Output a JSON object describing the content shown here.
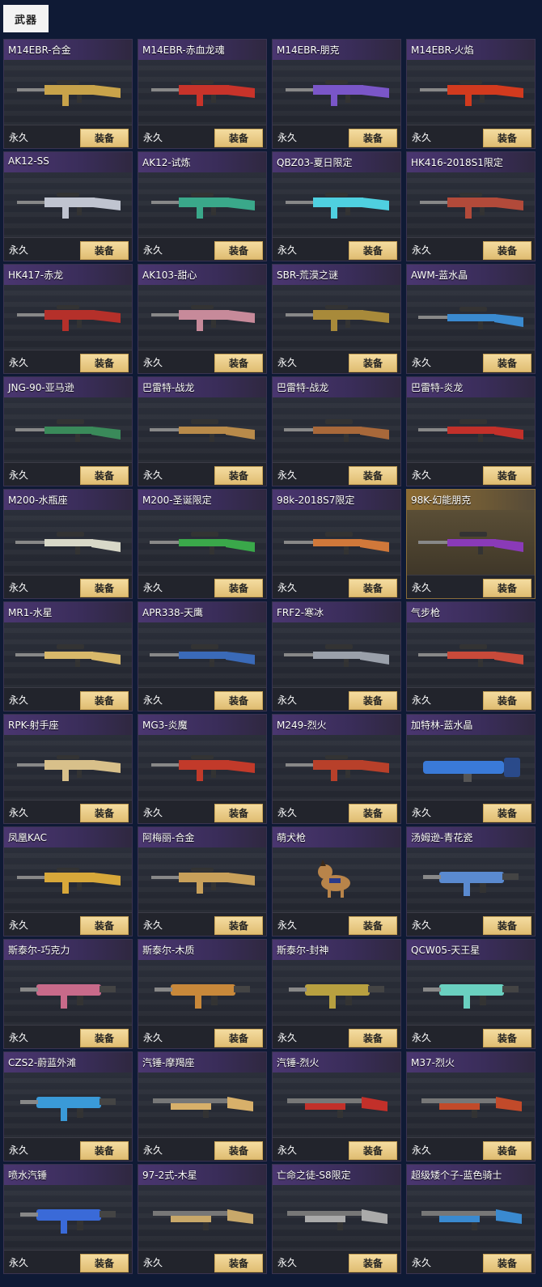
{
  "header": {
    "tab_label": "武器"
  },
  "weapons": [
    {
      "name": "M14EBR-合金",
      "duration": "永久",
      "button": "装备",
      "color": "#c8a34a",
      "icon": "rifle-icon"
    },
    {
      "name": "M14EBR-赤血龙魂",
      "duration": "永久",
      "button": "装备",
      "color": "#c8332a",
      "icon": "rifle-icon"
    },
    {
      "name": "M14EBR-朋克",
      "duration": "永久",
      "button": "装备",
      "color": "#7a56c8",
      "icon": "rifle-icon"
    },
    {
      "name": "M14EBR-火焰",
      "duration": "永久",
      "button": "装备",
      "color": "#d23a1e",
      "icon": "rifle-icon"
    },
    {
      "name": "AK12-SS",
      "duration": "永久",
      "button": "装备",
      "color": "#c0c4d0",
      "icon": "rifle-icon"
    },
    {
      "name": "AK12-试炼",
      "duration": "永久",
      "button": "装备",
      "color": "#3aa88a",
      "icon": "rifle-icon"
    },
    {
      "name": "QBZ03-夏日限定",
      "duration": "永久",
      "button": "装备",
      "color": "#4fd0e0",
      "icon": "rifle-icon"
    },
    {
      "name": "HK416-2018S1限定",
      "duration": "永久",
      "button": "装备",
      "color": "#b24a3a",
      "icon": "rifle-icon"
    },
    {
      "name": "HK417-赤龙",
      "duration": "永久",
      "button": "装备",
      "color": "#b5302a",
      "icon": "rifle-icon"
    },
    {
      "name": "AK103-甜心",
      "duration": "永久",
      "button": "装备",
      "color": "#c78a9a",
      "icon": "rifle-icon"
    },
    {
      "name": "SBR-荒漠之谜",
      "duration": "永久",
      "button": "装备",
      "color": "#a88a3a",
      "icon": "rifle-icon"
    },
    {
      "name": "AWM-蓝水晶",
      "duration": "永久",
      "button": "装备",
      "color": "#3a8ad0",
      "icon": "sniper-icon"
    },
    {
      "name": "JNG-90-亚马逊",
      "duration": "永久",
      "button": "装备",
      "color": "#3a8a5a",
      "icon": "sniper-icon"
    },
    {
      "name": "巴雷特-战龙",
      "duration": "永久",
      "button": "装备",
      "color": "#b88a4a",
      "icon": "sniper-icon"
    },
    {
      "name": "巴雷特-战龙",
      "duration": "永久",
      "button": "装备",
      "color": "#a8683a",
      "icon": "sniper-icon"
    },
    {
      "name": "巴雷特-炎龙",
      "duration": "永久",
      "button": "装备",
      "color": "#c2302a",
      "icon": "sniper-icon"
    },
    {
      "name": "M200-水瓶座",
      "duration": "永久",
      "button": "装备",
      "color": "#d8d8c8",
      "icon": "sniper-icon"
    },
    {
      "name": "M200-圣诞限定",
      "duration": "永久",
      "button": "装备",
      "color": "#3aa84a",
      "icon": "sniper-icon"
    },
    {
      "name": "98k-2018S7限定",
      "duration": "永久",
      "button": "装备",
      "color": "#d0783a",
      "icon": "sniper-icon"
    },
    {
      "name": "98K-幻能朋克",
      "duration": "永久",
      "button": "装备",
      "color": "#8a3ab8",
      "icon": "sniper-icon"
    },
    {
      "name": "MR1-水星",
      "duration": "永久",
      "button": "装备",
      "color": "#d8b86a",
      "icon": "sniper-icon"
    },
    {
      "name": "APR338-天鹰",
      "duration": "永久",
      "button": "装备",
      "color": "#3a6ab8",
      "icon": "sniper-icon"
    },
    {
      "name": "FRF2-寒冰",
      "duration": "永久",
      "button": "装备",
      "color": "#9aa0aa",
      "icon": "sniper-icon"
    },
    {
      "name": "气步枪",
      "duration": "永久",
      "button": "装备",
      "color": "#c84a3a",
      "icon": "sniper-icon"
    },
    {
      "name": "RPK-射手座",
      "duration": "永久",
      "button": "装备",
      "color": "#d8c08a",
      "icon": "machine-gun-icon"
    },
    {
      "name": "MG3-炎魔",
      "duration": "永久",
      "button": "装备",
      "color": "#c23a2a",
      "icon": "machine-gun-icon"
    },
    {
      "name": "M249-烈火",
      "duration": "永久",
      "button": "装备",
      "color": "#b8402a",
      "icon": "machine-gun-icon"
    },
    {
      "name": "加特林-蓝水晶",
      "duration": "永久",
      "button": "装备",
      "color": "#3a7ad8",
      "icon": "gatling-icon"
    },
    {
      "name": "凤凰KAC",
      "duration": "永久",
      "button": "装备",
      "color": "#d8a83a",
      "icon": "machine-gun-icon"
    },
    {
      "name": "阿梅丽-合金",
      "duration": "永久",
      "button": "装备",
      "color": "#c8a05a",
      "icon": "machine-gun-icon"
    },
    {
      "name": "萌犬枪",
      "duration": "永久",
      "button": "装备",
      "color": "#b8844a",
      "icon": "dog-gun-icon"
    },
    {
      "name": "汤姆逊-青花瓷",
      "duration": "永久",
      "button": "装备",
      "color": "#5a8ad0",
      "icon": "smg-icon"
    },
    {
      "name": "斯泰尔-巧克力",
      "duration": "永久",
      "button": "装备",
      "color": "#c86a8a",
      "icon": "smg-icon"
    },
    {
      "name": "斯泰尔-木质",
      "duration": "永久",
      "button": "装备",
      "color": "#c8883a",
      "icon": "smg-icon"
    },
    {
      "name": "斯泰尔-封神",
      "duration": "永久",
      "button": "装备",
      "color": "#b8a040",
      "icon": "smg-icon"
    },
    {
      "name": "QCW05-天王星",
      "duration": "永久",
      "button": "装备",
      "color": "#6ad0c0",
      "icon": "smg-icon"
    },
    {
      "name": "CZS2-蔚蓝外滩",
      "duration": "永久",
      "button": "装备",
      "color": "#3a9ad8",
      "icon": "smg-icon"
    },
    {
      "name": "汽锤-摩羯座",
      "duration": "永久",
      "button": "装备",
      "color": "#d8b06a",
      "icon": "shotgun-icon"
    },
    {
      "name": "汽锤-烈火",
      "duration": "永久",
      "button": "装备",
      "color": "#c2302a",
      "icon": "shotgun-icon"
    },
    {
      "name": "M37-烈火",
      "duration": "永久",
      "button": "装备",
      "color": "#c24a2a",
      "icon": "shotgun-icon"
    },
    {
      "name": "喷水汽锤",
      "duration": "永久",
      "button": "装备",
      "color": "#3a6ad8",
      "icon": "water-gun-icon"
    },
    {
      "name": "97-2式-木星",
      "duration": "永久",
      "button": "装备",
      "color": "#c8a86a",
      "icon": "shotgun-icon"
    },
    {
      "name": "亡命之徒-S8限定",
      "duration": "永久",
      "button": "装备",
      "color": "#aaaaaa",
      "icon": "shotgun-icon"
    },
    {
      "name": "超级矮个子-蓝色骑士",
      "duration": "永久",
      "button": "装备",
      "color": "#3a8ad0",
      "icon": "shotgun-icon"
    }
  ]
}
